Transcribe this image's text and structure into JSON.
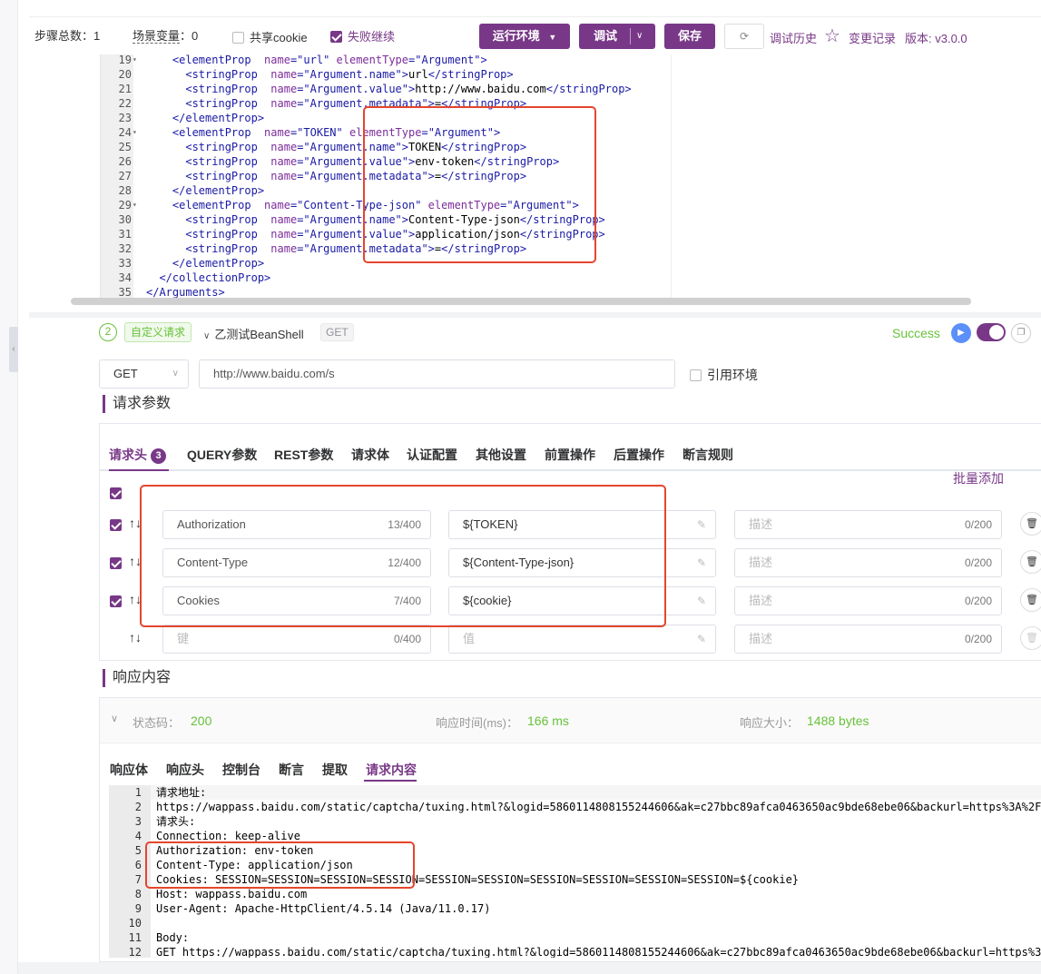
{
  "toolbar": {
    "steps_label": "步骤总数：",
    "steps_value": "1",
    "vars_label": "场景变量",
    "vars_value": "0",
    "share_cookie_label": "共享cookie",
    "share_cookie_checked": false,
    "fail_continue_label": "失败继续",
    "fail_continue_checked": true,
    "env_button": "运行环境",
    "debug_button": "调试",
    "save_button": "保存",
    "history_link": "调试历史",
    "changelog_link": "变更记录",
    "version_text": "版本: v3.0.0"
  },
  "code_editor": {
    "lines": [
      {
        "n": "19",
        "fold": true,
        "text": "    <elementProp  name=\"url\" elementType=\"Argument\">"
      },
      {
        "n": "20",
        "fold": false,
        "text": "      <stringProp  name=\"Argument.name\">url</stringProp>"
      },
      {
        "n": "21",
        "fold": false,
        "text": "      <stringProp  name=\"Argument.value\">http://www.baidu.com</stringProp>"
      },
      {
        "n": "22",
        "fold": false,
        "text": "      <stringProp  name=\"Argument.metadata\">=</stringProp>"
      },
      {
        "n": "23",
        "fold": false,
        "text": "    </elementProp>"
      },
      {
        "n": "24",
        "fold": true,
        "text": "    <elementProp  name=\"TOKEN\" elementType=\"Argument\">"
      },
      {
        "n": "25",
        "fold": false,
        "text": "      <stringProp  name=\"Argument.name\">TOKEN</stringProp>"
      },
      {
        "n": "26",
        "fold": false,
        "text": "      <stringProp  name=\"Argument.value\">env-token</stringProp>"
      },
      {
        "n": "27",
        "fold": false,
        "text": "      <stringProp  name=\"Argument.metadata\">=</stringProp>"
      },
      {
        "n": "28",
        "fold": false,
        "text": "    </elementProp>"
      },
      {
        "n": "29",
        "fold": true,
        "text": "    <elementProp  name=\"Content-Type-json\" elementType=\"Argument\">"
      },
      {
        "n": "30",
        "fold": false,
        "text": "      <stringProp  name=\"Argument.name\">Content-Type-json</stringProp>"
      },
      {
        "n": "31",
        "fold": false,
        "text": "      <stringProp  name=\"Argument.value\">application/json</stringProp>"
      },
      {
        "n": "32",
        "fold": false,
        "text": "      <stringProp  name=\"Argument.metadata\">=</stringProp>"
      },
      {
        "n": "33",
        "fold": false,
        "text": "    </elementProp>"
      },
      {
        "n": "34",
        "fold": false,
        "text": "  </collectionProp>"
      },
      {
        "n": "35",
        "fold": false,
        "text": "</Arguments>"
      }
    ]
  },
  "step": {
    "number": "2",
    "type_tag": "自定义请求",
    "name": "乙测试BeanShell",
    "method_tag": "GET",
    "status": "Success",
    "enabled": true
  },
  "request": {
    "method": "GET",
    "url": "http://www.baidu.com/s",
    "use_env_label": "引用环境",
    "use_env_checked": false,
    "params_title": "请求参数",
    "tabs": [
      "请求头",
      "QUERY参数",
      "REST参数",
      "请求体",
      "认证配置",
      "其他设置",
      "前置操作",
      "后置操作",
      "断言规则"
    ],
    "header_count": "3",
    "batch_add": "批量添加",
    "headers": [
      {
        "checked": true,
        "key": "Authorization",
        "key_count": "13/400",
        "value": "${TOKEN}",
        "desc": "描述",
        "desc_count": "0/200"
      },
      {
        "checked": true,
        "key": "Content-Type",
        "key_count": "12/400",
        "value": "${Content-Type-json}",
        "desc": "描述",
        "desc_count": "0/200"
      },
      {
        "checked": true,
        "key": "Cookies",
        "key_count": "7/400",
        "value": "${cookie}",
        "desc": "描述",
        "desc_count": "0/200"
      }
    ],
    "empty_row": {
      "key_placeholder": "键",
      "key_count": "0/400",
      "value_placeholder": "值",
      "desc_placeholder": "描述",
      "desc_count": "0/200"
    }
  },
  "response": {
    "title": "响应内容",
    "status_label": "状态码：",
    "status_value": "200",
    "time_label": "响应时间(ms)：",
    "time_value": "166 ms",
    "size_label": "响应大小：",
    "size_value": "1488 bytes",
    "tabs": [
      "响应体",
      "响应头",
      "控制台",
      "断言",
      "提取",
      "请求内容"
    ],
    "active_tab": "请求内容",
    "lines": [
      {
        "n": "1",
        "text": "请求地址:"
      },
      {
        "n": "2",
        "text": "https://wappass.baidu.com/static/captcha/tuxing.html?&logid=5860114808155244606&ak=c27bbc89afca0463650ac9bde68ebe06&backurl=https%3A%2F"
      },
      {
        "n": "3",
        "text": "请求头:"
      },
      {
        "n": "4",
        "text": "Connection: keep-alive"
      },
      {
        "n": "5",
        "text": "Authorization: env-token"
      },
      {
        "n": "6",
        "text": "Content-Type: application/json"
      },
      {
        "n": "7",
        "text": "Cookies: SESSION=SESSION=SESSION=SESSION=SESSION=SESSION=SESSION=SESSION=SESSION=SESSION=${cookie}"
      },
      {
        "n": "8",
        "text": "Host: wappass.baidu.com"
      },
      {
        "n": "9",
        "text": "User-Agent: Apache-HttpClient/4.5.14 (Java/11.0.17)"
      },
      {
        "n": "10",
        "text": ""
      },
      {
        "n": "11",
        "text": "Body:"
      },
      {
        "n": "12",
        "text": "GET https://wappass.baidu.com/static/captcha/tuxing.html?&logid=5860114808155244606&ak=c27bbc89afca0463650ac9bde68ebe06&backurl=https%3"
      }
    ]
  },
  "colors": {
    "accent": "#783887",
    "success": "#67c23a",
    "highlight_box": "#e5452e"
  }
}
